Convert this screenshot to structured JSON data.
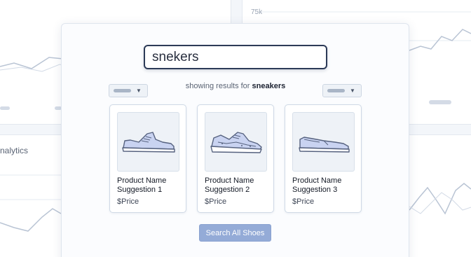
{
  "background": {
    "axis_label": "75k",
    "panel_title": "nalytics"
  },
  "search": {
    "value": "snekers",
    "button_icon": "search-icon"
  },
  "results": {
    "prefix": "showing results for ",
    "query": "sneakers"
  },
  "products": [
    {
      "name": "Product Name Suggestion 1",
      "price": "$Price",
      "image": "sneaker-icon"
    },
    {
      "name": "Product Name Suggestion 2",
      "price": "$Price",
      "image": "running-shoe-icon"
    },
    {
      "name": "Product Name Suggestion 3",
      "price": "$Price",
      "image": "slip-on-shoe-icon"
    }
  ],
  "actions": {
    "search_all_label": "Search All Shoes"
  },
  "colors": {
    "search_button": "#2b3c63",
    "search_all_button": "#94abd7",
    "shoe_fill": "#c9d3f1",
    "shoe_stroke": "#56627f"
  }
}
